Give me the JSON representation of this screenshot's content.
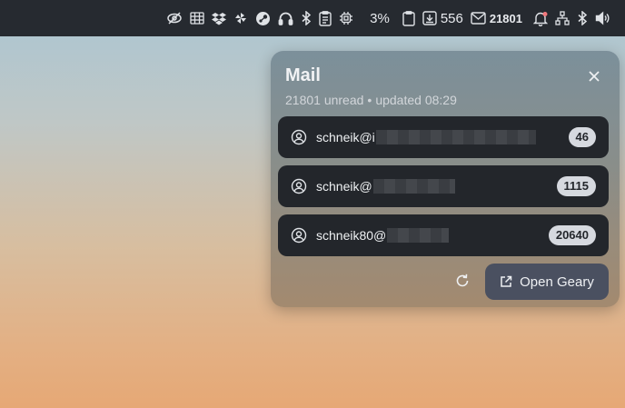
{
  "topbar": {
    "battery_percent": "3%",
    "downloads_count": "556",
    "mail_unread": "21801"
  },
  "popup": {
    "title": "Mail",
    "unread_text": "21801 unread",
    "separator": "•",
    "updated_text": "updated 08:29",
    "accounts": [
      {
        "email_visible": "schneik@i",
        "count": "46"
      },
      {
        "email_visible": "schneik@",
        "count": "1115"
      },
      {
        "email_visible": "schneik80@",
        "count": "20640"
      }
    ],
    "open_button_label": "Open Geary"
  },
  "icons": {
    "tray": [
      "eye-slash-icon",
      "grid-icon",
      "dropbox-icon",
      "pinwheel-icon",
      "steam-icon",
      "headset-icon",
      "bluetooth-icon",
      "clipboard-list-icon",
      "cpu-icon",
      "battery-icon",
      "clipboard-icon",
      "download-icon",
      "mail-icon",
      "bell-icon",
      "network-icon",
      "bluetooth-icon",
      "volume-icon"
    ],
    "popup": [
      "close-icon",
      "user-circle-icon",
      "refresh-icon",
      "external-link-icon"
    ]
  },
  "colors": {
    "topbar_bg": "#262a30",
    "account_bg": "#23262b",
    "badge_bg": "#d6d9df",
    "button_bg": "#4a5060",
    "notification_dot": "#f0787c"
  }
}
